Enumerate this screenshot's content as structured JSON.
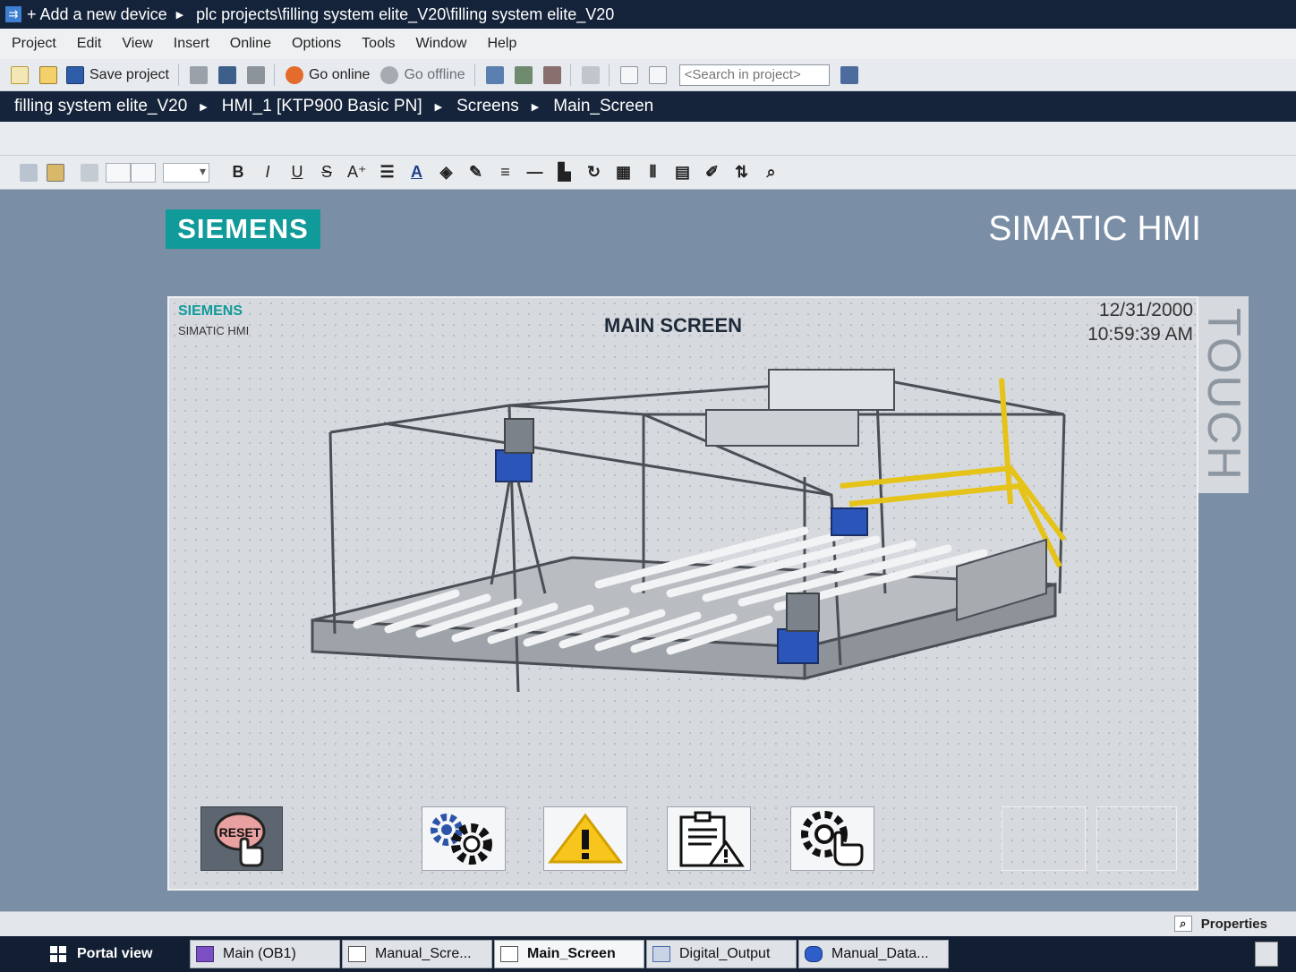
{
  "titlebar": {
    "add_device": "+ Add a new device",
    "path": "plc projects\\filling system elite_V20\\filling system elite_V20"
  },
  "menu": [
    "Project",
    "Edit",
    "View",
    "Insert",
    "Online",
    "Options",
    "Tools",
    "Window",
    "Help"
  ],
  "toolbar": {
    "save_label": "Save project",
    "go_online_label": "Go online",
    "go_offline_label": "Go offline",
    "search_placeholder": "<Search in project>"
  },
  "breadcrumb": [
    "filling system elite_V20",
    "HMI_1 [KTP900 Basic PN]",
    "Screens",
    "Main_Screen"
  ],
  "format_toolbar": {
    "bold": "B",
    "italic": "I",
    "underline": "U",
    "strike": "S",
    "superscript": "A⁺"
  },
  "editor": {
    "brand_logo": "SIEMENS",
    "product_title": "SIMATIC HMI",
    "touch_label": "TOUCH"
  },
  "panel": {
    "logo": "SIEMENS",
    "logo_sub": "SIMATIC HMI",
    "screen_title": "MAIN SCREEN",
    "date": "12/31/2000",
    "time": "10:59:39 AM",
    "buttons": {
      "reset_label": "RESET"
    }
  },
  "properties_label": "Properties",
  "taskbar": {
    "portal_view": "Portal view",
    "tasks": [
      "Main (OB1)",
      "Manual_Scre...",
      "Main_Screen",
      "Digital_Output",
      "Manual_Data..."
    ]
  },
  "colors": {
    "siemens_teal": "#109a9a",
    "titlebar_navy": "#14233a",
    "editor_bg": "#7a8ea6"
  }
}
